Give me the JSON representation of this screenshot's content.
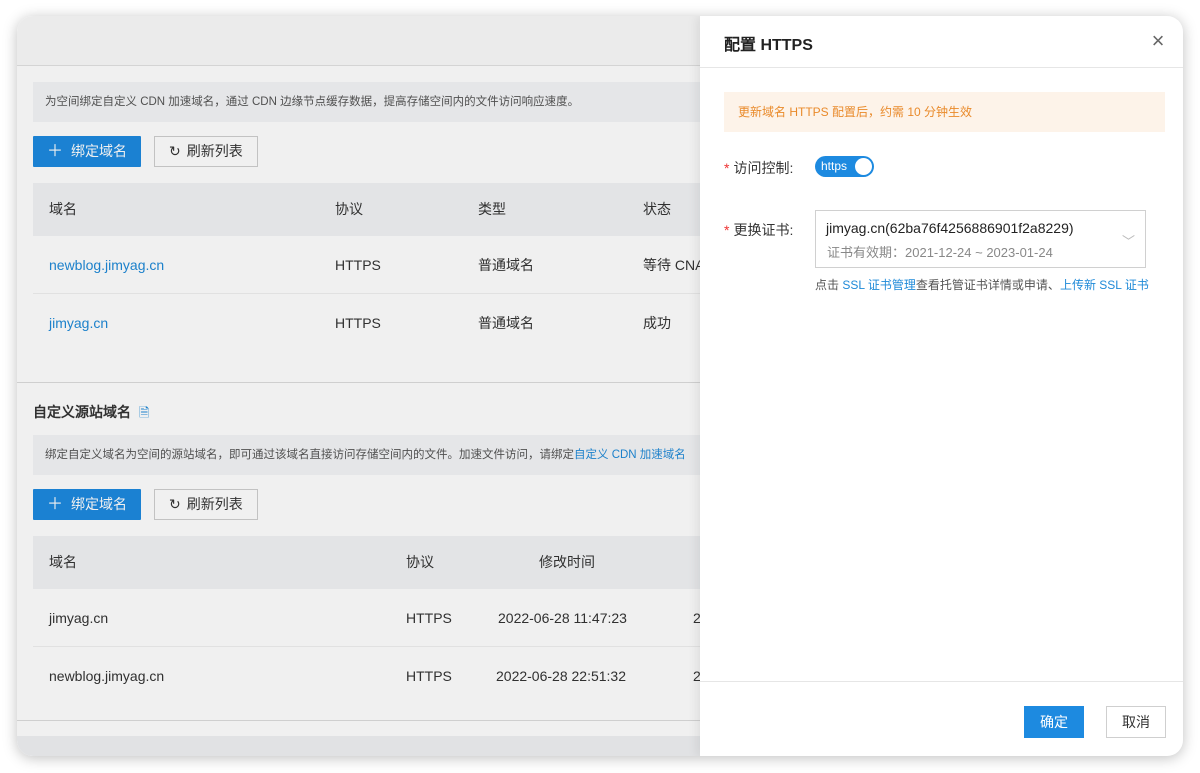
{
  "cdn_section": {
    "notice": "为空间绑定自定义 CDN 加速域名，通过 CDN 边缘节点缓存数据，提高存储空间内的文件访问响应速度。",
    "bind_label": "绑定域名",
    "refresh_label": "刷新列表",
    "columns": [
      "域名",
      "协议",
      "类型",
      "状态"
    ],
    "rows": [
      {
        "domain": "newblog.jimyag.cn",
        "protocol": "HTTPS",
        "type": "普通域名",
        "status": "等待 CNA"
      },
      {
        "domain": "jimyag.cn",
        "protocol": "HTTPS",
        "type": "普通域名",
        "status": "成功"
      }
    ]
  },
  "origin_section": {
    "title": "自定义源站域名",
    "notice_prefix": "绑定自定义域名为空间的源站域名，即可通过该域名直接访问存储空间内的文件。加速文件访问，请绑定",
    "notice_link": "自定义 CDN 加速域名",
    "bind_label": "绑定域名",
    "refresh_label": "刷新列表",
    "columns": [
      "域名",
      "协议",
      "修改时间"
    ],
    "rows": [
      {
        "domain": "jimyag.cn",
        "protocol": "HTTPS",
        "modified": "2022-06-28 11:47:23",
        "extra": "2"
      },
      {
        "domain": "newblog.jimyag.cn",
        "protocol": "HTTPS",
        "modified": "2022-06-28 22:51:32",
        "extra": "2"
      }
    ]
  },
  "drawer": {
    "title": "配置 HTTPS",
    "warning": "更新域名 HTTPS 配置后，约需 10 分钟生效",
    "access_label": "访问控制:",
    "switch_text": "https",
    "switch_on": true,
    "cert_label": "更换证书:",
    "cert_value": "jimyag.cn(62ba76f4256886901f2a8229)",
    "cert_validity": "证书有效期：2021-12-24 ~ 2023-01-24",
    "help_prefix": "点击 ",
    "help_link1": "SSL 证书管理",
    "help_middle": "查看托管证书详情或申请、",
    "help_link2": "上传新 SSL 证书",
    "ok_label": "确定",
    "cancel_label": "取消"
  },
  "colors": {
    "primary": "#1d8ae0",
    "link": "#1f8ad8",
    "warning_text": "#e98a2a",
    "warning_bg": "#fdf3e9"
  }
}
